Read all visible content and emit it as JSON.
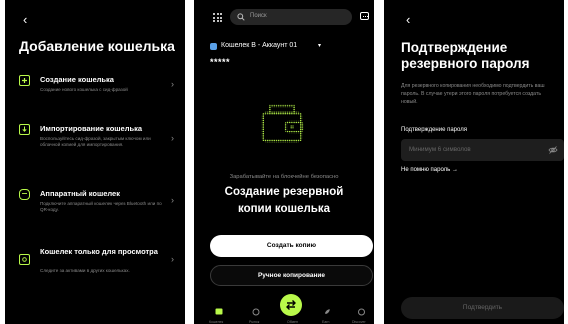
{
  "add_wallet": {
    "back_glyph": "‹",
    "title": "Добавление кошелька",
    "options": [
      {
        "title": "Создание кошелька",
        "desc": "Создание нового кошелька с сид-фразой",
        "icon": "plus-square-icon"
      },
      {
        "title": "Импортирование кошелька",
        "desc": "Воспользуйтесь сид-фразой, закрытым ключом или облачной копией для импортирования.",
        "icon": "import-arrow-icon"
      },
      {
        "title": "Аппаратный кошелек",
        "desc": "Подключите аппаратный кошелек через Bluetooth или по QR-коду.",
        "icon": "hardware-key-icon"
      },
      {
        "title": "Кошелек только для просмотра",
        "desc": "Следите за активами в других кошельках.",
        "icon": "eye-icon"
      }
    ],
    "chevron_glyph": "›"
  },
  "backup": {
    "search_placeholder": "Поиск",
    "account_name": "Кошелек B - Аккаунт 01",
    "account_chevron": "▾",
    "balance_masked": "*****",
    "subtitle": "Зарабатывайте на блокчейне безопасно",
    "title_line1": "Создание резервной",
    "title_line2": "копии кошелька",
    "create_copy_label": "Создать копию",
    "manual_copy_label": "Ручное копирование",
    "nav_labels": [
      "Кошелек",
      "Рынок",
      "Обмен",
      "Earn",
      "Discover"
    ]
  },
  "confirm": {
    "back_glyph": "‹",
    "title": "Подтверждение резервного пароля",
    "description": "Для резервного копирования необходимо подтвердить ваш пароль. В случае утери этого пароля потребуется создать новый.",
    "field_label": "Подтверждение пароля",
    "field_placeholder": "Минимум 6 символов",
    "forgot_label": "Не помню пароль →",
    "confirm_label": "Подтвердить"
  },
  "colors": {
    "accent": "#b9f94a",
    "background": "#000000"
  }
}
